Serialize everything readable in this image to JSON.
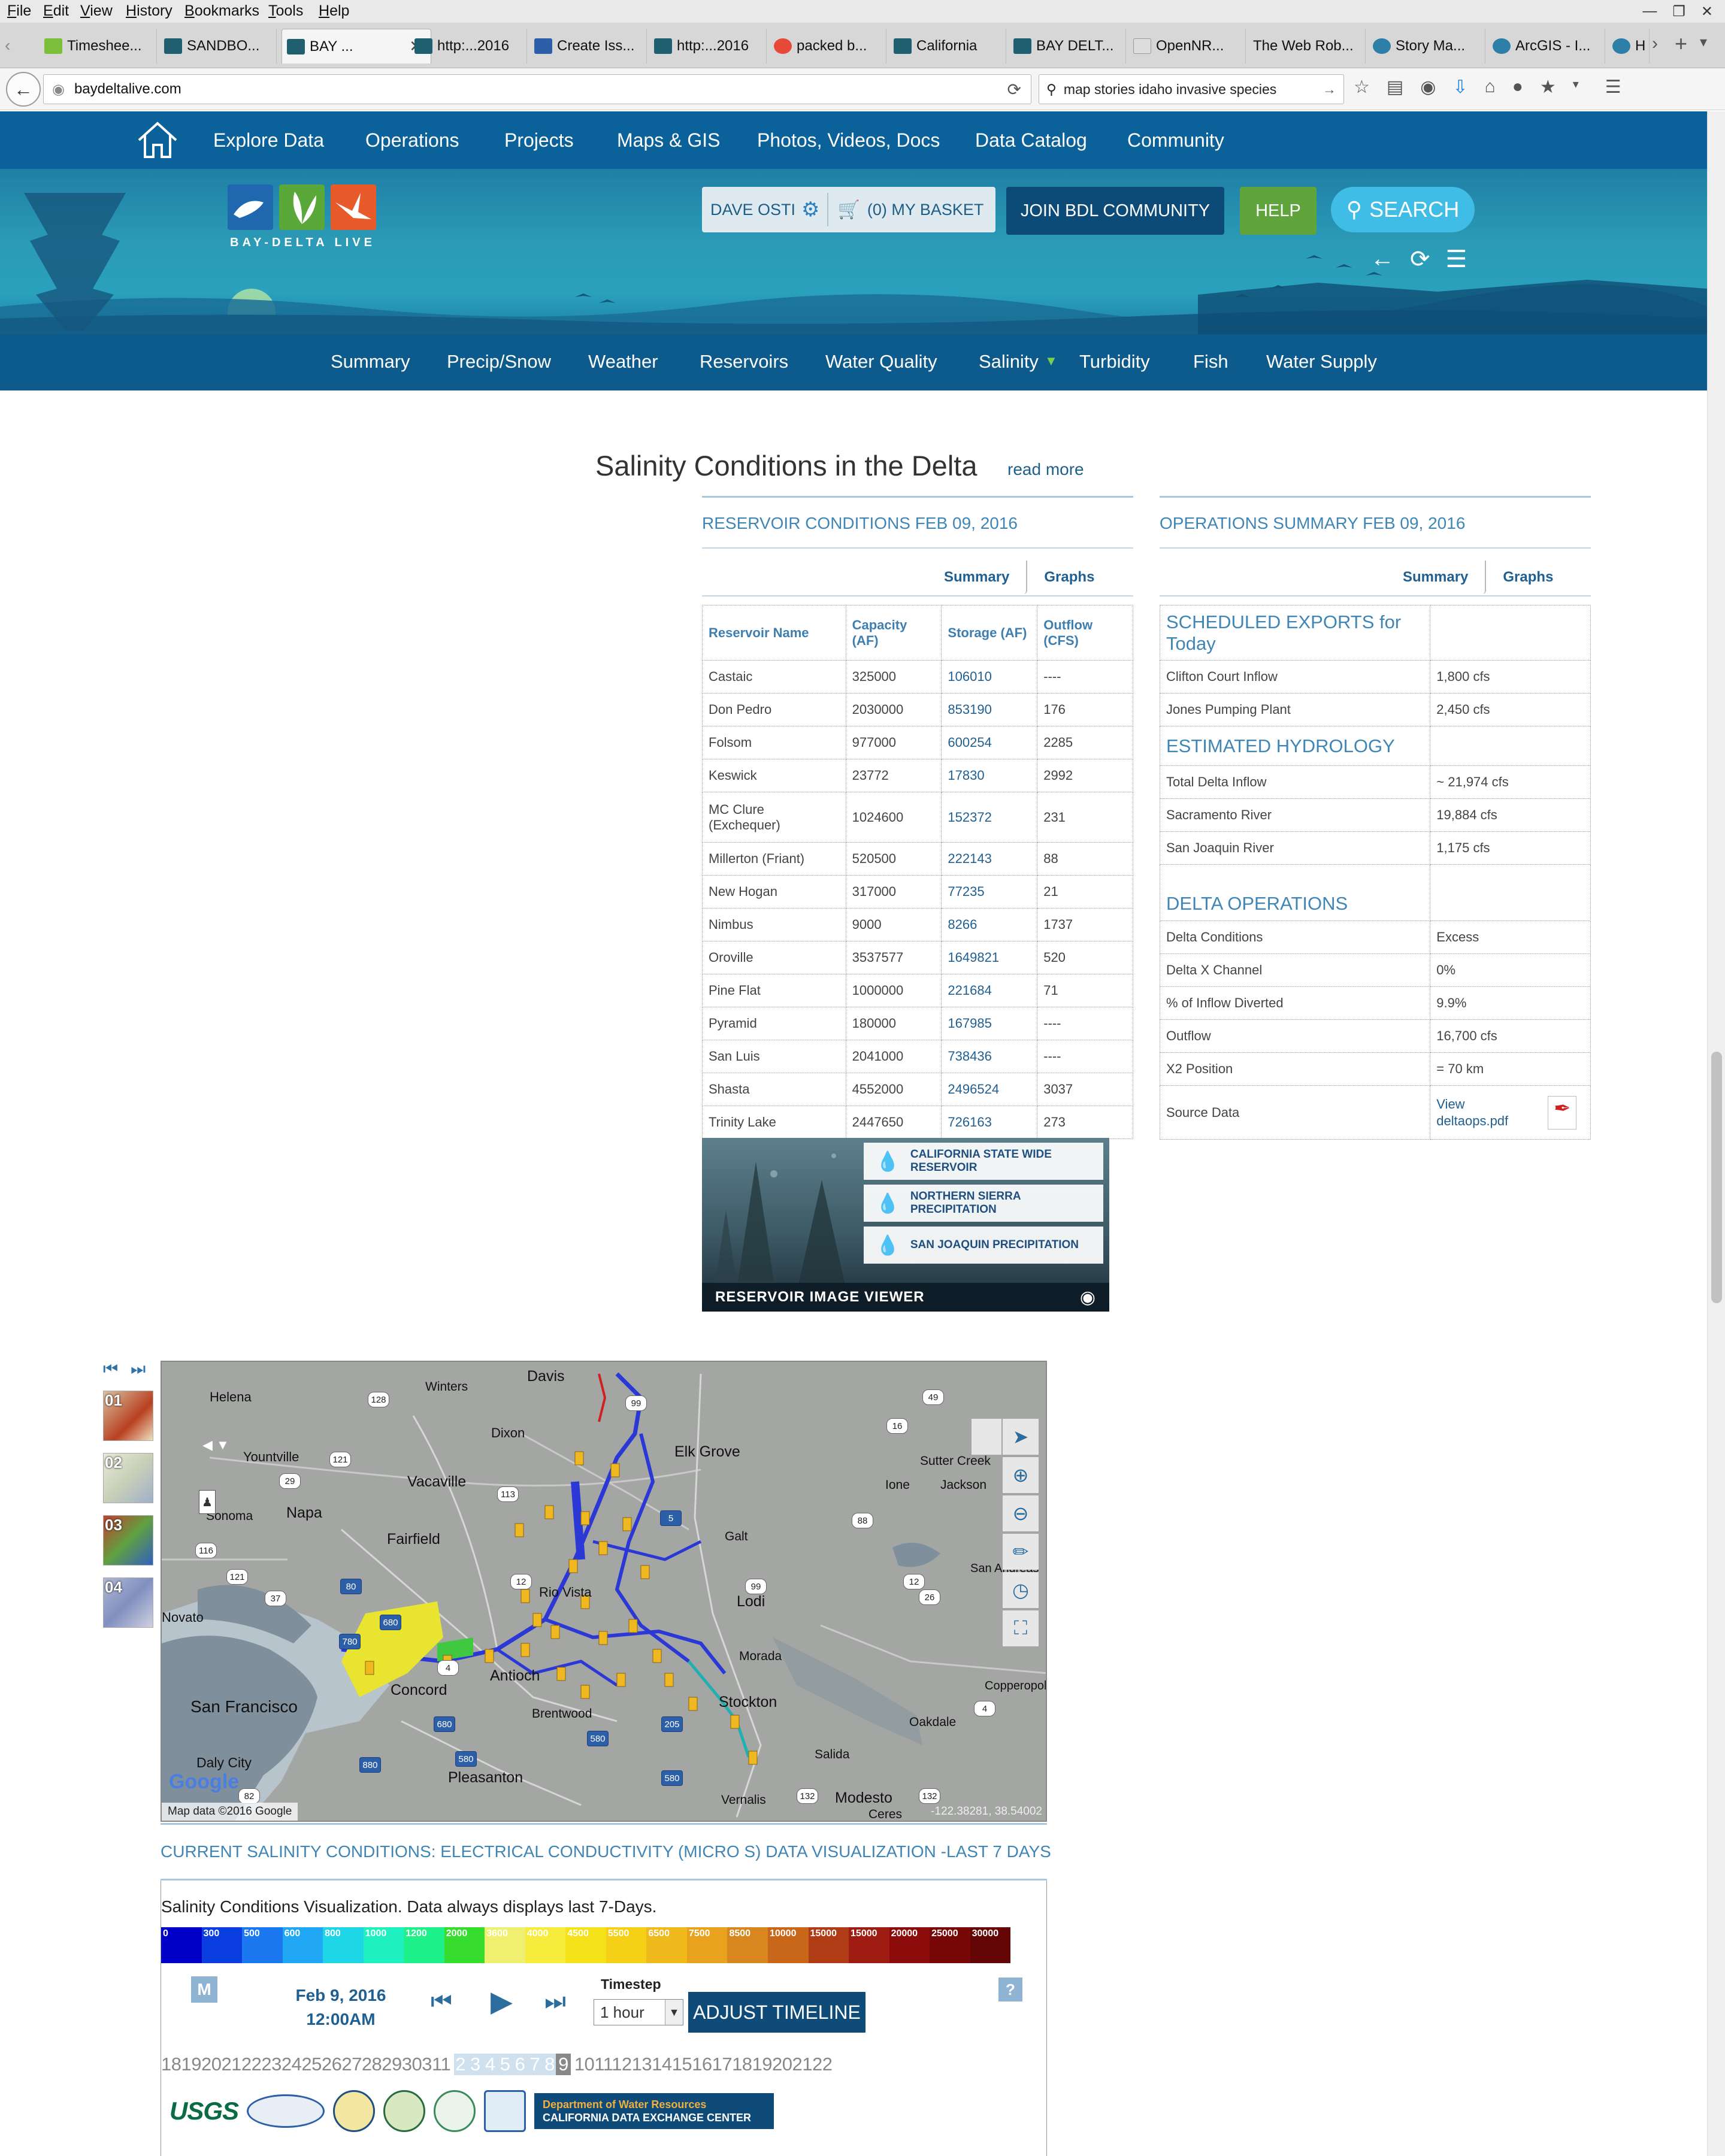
{
  "browser": {
    "menu": [
      "File",
      "Edit",
      "View",
      "History",
      "Bookmarks",
      "Tools",
      "Help"
    ],
    "tabs": [
      {
        "label": "Timeshee...",
        "color": "#7cbf3a"
      },
      {
        "label": "SANDBO...",
        "color": "#1f5f6f"
      },
      {
        "label": "BAY ...",
        "color": "#1f5f6f",
        "active": true
      },
      {
        "label": "http:...2016",
        "color": "#1f5f6f"
      },
      {
        "label": "Create Iss...",
        "color": "#2d5fa8"
      },
      {
        "label": "http:...2016",
        "color": "#1f5f6f"
      },
      {
        "label": "packed b...",
        "color": "#e84a3a"
      },
      {
        "label": "California",
        "color": "#1f5f6f"
      },
      {
        "label": "BAY DELT...",
        "color": "#1f5f6f"
      },
      {
        "label": "OpenNR...",
        "color": "#dddddd"
      },
      {
        "label": "The Web Rob...",
        "color": "#dddddd"
      },
      {
        "label": "Story Ma...",
        "color": "#2d7fa8"
      },
      {
        "label": "ArcGIS - I...",
        "color": "#2d7fa8"
      },
      {
        "label": "H",
        "color": "#2d7fa8"
      }
    ],
    "url": "baydeltalive.com",
    "search_text": "map stories idaho invasive species"
  },
  "site": {
    "nav": [
      "Explore Data",
      "Operations",
      "Projects",
      "Maps & GIS",
      "Photos, Videos, Docs",
      "Data Catalog",
      "Community"
    ],
    "logo_text": "BAY-DELTA LIVE",
    "user_name": "DAVE OSTI",
    "basket": "(0) MY BASKET",
    "join": "JOIN BDL COMMUNITY",
    "help": "HELP",
    "search": "SEARCH",
    "subnav": [
      "Summary",
      "Precip/Snow",
      "Weather",
      "Reservoirs",
      "Water Quality",
      "Salinity",
      "Turbidity",
      "Fish",
      "Water Supply"
    ],
    "colors": {
      "nav_bg": "#0b6199",
      "subnav_bg": "#0c5b8c",
      "accent": "#3f86b6",
      "link": "#1f5f91"
    }
  },
  "page": {
    "title": "Salinity Conditions in the Delta",
    "read_more": "read more"
  },
  "reservoir": {
    "title": "RESERVOIR CONDITIONS FEB 09, 2016",
    "tabs": [
      "Summary",
      "Graphs"
    ],
    "headers": [
      "Reservoir Name",
      "Capacity (AF)",
      "Storage (AF)",
      "Outflow (CFS)"
    ],
    "rows": [
      [
        "Castaic",
        "325000",
        "106010",
        "----"
      ],
      [
        "Don Pedro",
        "2030000",
        "853190",
        "176"
      ],
      [
        "Folsom",
        "977000",
        "600254",
        "2285"
      ],
      [
        "Keswick",
        "23772",
        "17830",
        "2992"
      ],
      [
        "MC Clure (Exchequer)",
        "1024600",
        "152372",
        "231"
      ],
      [
        "Millerton (Friant)",
        "520500",
        "222143",
        "88"
      ],
      [
        "New Hogan",
        "317000",
        "77235",
        "21"
      ],
      [
        "Nimbus",
        "9000",
        "8266",
        "1737"
      ],
      [
        "Oroville",
        "3537577",
        "1649821",
        "520"
      ],
      [
        "Pine Flat",
        "1000000",
        "221684",
        "71"
      ],
      [
        "Pyramid",
        "180000",
        "167985",
        "----"
      ],
      [
        "San Luis",
        "2041000",
        "738436",
        "----"
      ],
      [
        "Shasta",
        "4552000",
        "2496524",
        "3037"
      ],
      [
        "Trinity Lake",
        "2447650",
        "726163",
        "273"
      ]
    ]
  },
  "viewer": {
    "items": [
      "CALIFORNIA STATE WIDE RESERVOIR",
      "NORTHERN SIERRA PRECIPITATION",
      "SAN JOAQUIN PRECIPITATION"
    ],
    "label": "RESERVOIR IMAGE VIEWER"
  },
  "operations": {
    "title": "OPERATIONS SUMMARY FEB 09, 2016",
    "tabs": [
      "Summary",
      "Graphs"
    ],
    "sections": {
      "exports": "SCHEDULED EXPORTS for Today",
      "hydrology": "ESTIMATED HYDROLOGY",
      "delta": "DELTA OPERATIONS"
    },
    "rows": {
      "clifton_label": "Clifton Court Inflow",
      "clifton_value": "1,800 cfs",
      "jones_label": "Jones Pumping Plant",
      "jones_value": "2,450 cfs",
      "total_label": "Total Delta Inflow",
      "total_value": "~ 21,974 cfs",
      "sac_label": "Sacramento River",
      "sac_value": "19,884 cfs",
      "sj_label": "San Joaquin River",
      "sj_value": "1,175 cfs",
      "cond_label": "Delta Conditions",
      "cond_value": "Excess",
      "xchan_label": "Delta X Channel",
      "xchan_value": "0%",
      "div_label": "% of Inflow Diverted",
      "div_value": "9.9%",
      "out_label": "Outflow",
      "out_value": "16,700 cfs",
      "x2_label": "X2 Position",
      "x2_value": "= 70 km",
      "src_label": "Source Data",
      "src_value": "View deltaops.pdf"
    }
  },
  "map": {
    "thumbs": [
      "01",
      "02",
      "03",
      "04"
    ],
    "cities": [
      "Davis",
      "Winters",
      "Helena",
      "Dixon",
      "Elk Grove",
      "Yountville",
      "Vacaville",
      "Sutter Creek",
      "Ione",
      "Jackson",
      "Sonoma",
      "Napa",
      "Galt",
      "Fairfield",
      "Rio Vista",
      "Lodi",
      "San Andreas",
      "Novato",
      "Morada",
      "Concord",
      "Antioch",
      "Brentwood",
      "Stockton",
      "Copperopolis",
      "Oakdale",
      "San Francisco",
      "Daly City",
      "Pleasanton",
      "Salida",
      "Vernalis",
      "Modesto",
      "Ceres"
    ],
    "attribution": "Map data ©2016 Google",
    "google": "Google",
    "coords": "-122.38281, 38.54002",
    "caption": "CURRENT SALINITY CONDITIONS: ELECTRICAL CONDUCTIVITY (MICRO S) DATA VISUALIZATION -LAST 7 DAYS"
  },
  "viz": {
    "description": "Salinity Conditions Visualization. Data always displays last 7-Days.",
    "scale": [
      {
        "label": "0",
        "color": "#0000c8"
      },
      {
        "label": "300",
        "color": "#0a3ee0"
      },
      {
        "label": "500",
        "color": "#1b78f0"
      },
      {
        "label": "600",
        "color": "#20a8f5"
      },
      {
        "label": "800",
        "color": "#1fd6e6"
      },
      {
        "label": "1000",
        "color": "#1ff0c0"
      },
      {
        "label": "1200",
        "color": "#1ef08a"
      },
      {
        "label": "2000",
        "color": "#36dc2e"
      },
      {
        "label": "3600",
        "color": "#f0f070"
      },
      {
        "label": "4000",
        "color": "#f5ec3c"
      },
      {
        "label": "4500",
        "color": "#f5e21a"
      },
      {
        "label": "5500",
        "color": "#f5d016"
      },
      {
        "label": "6500",
        "color": "#f0b91c"
      },
      {
        "label": "7500",
        "color": "#e8a21e"
      },
      {
        "label": "8500",
        "color": "#d8861e"
      },
      {
        "label": "10000",
        "color": "#c8661a"
      },
      {
        "label": "15000",
        "color": "#b03c16"
      },
      {
        "label": "15000",
        "color": "#9e1c12"
      },
      {
        "label": "20000",
        "color": "#8c0c0c"
      },
      {
        "label": "25000",
        "color": "#780808"
      },
      {
        "label": "30000",
        "color": "#640606"
      }
    ],
    "m_button": "M",
    "date": "Feb 9, 2016",
    "time": "12:00AM",
    "timestep_label": "Timestep",
    "timestep_value": "1 hour",
    "adjust": "ADJUST TIMELINE",
    "help": "?",
    "days_before": "18192021222324252627282930311",
    "days_selected": "2 3 4 5 6 7 8",
    "day_current": "9",
    "days_after": "10111213141516171819202122",
    "logos": {
      "usgs": "USGS",
      "cdec_line1": "Department of Water Resources",
      "cdec_line2": "CALIFORNIA DATA EXCHANGE CENTER"
    }
  }
}
